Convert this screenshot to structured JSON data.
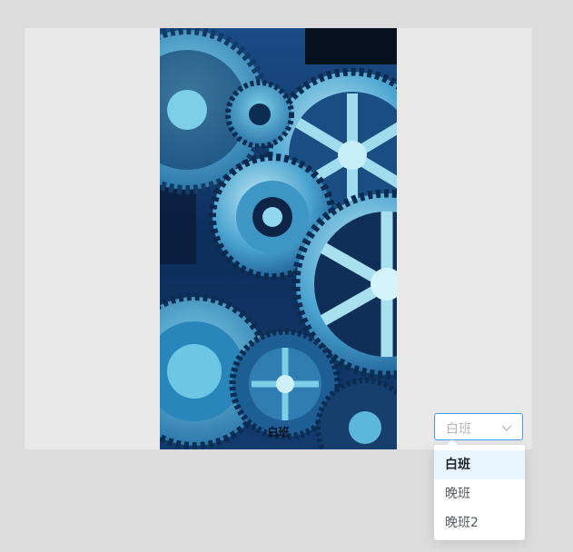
{
  "select": {
    "value": "白班",
    "options": [
      "白班",
      "晚班",
      "晚班2"
    ]
  },
  "image": {
    "caption": "白班"
  },
  "colors": {
    "accent": "#409eff",
    "selected_bg": "#e9f5ff"
  },
  "icons": {
    "select_chevron": "chevron-down-icon"
  }
}
